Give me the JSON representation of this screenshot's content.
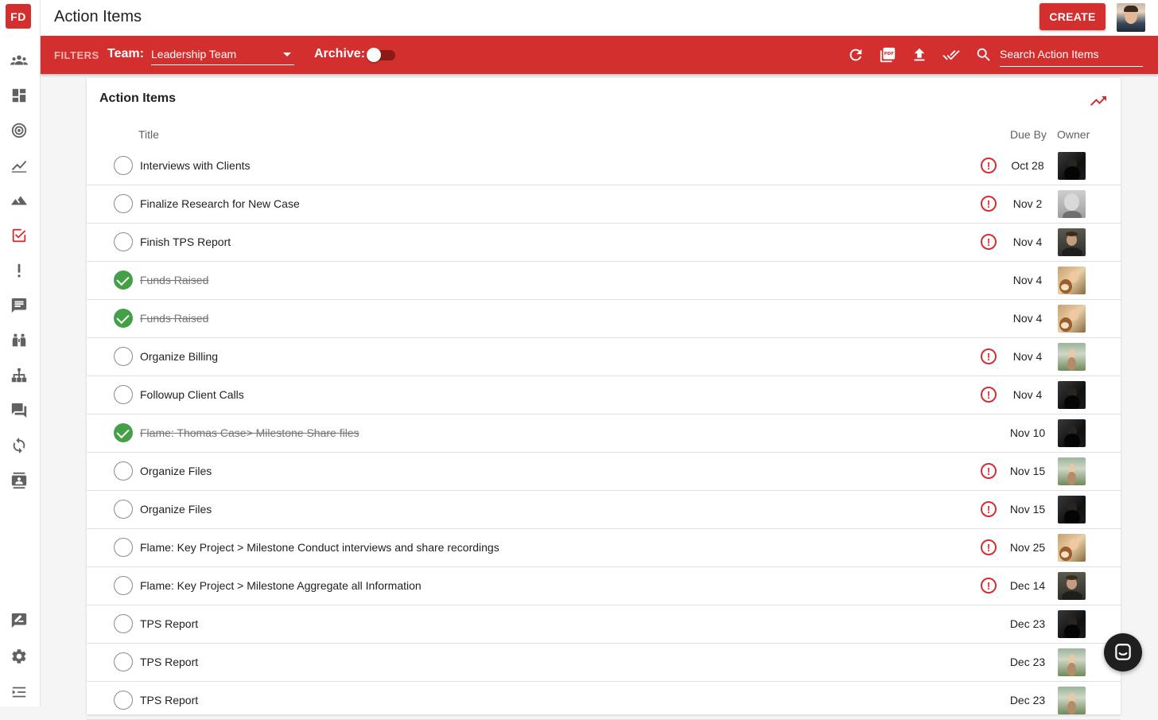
{
  "app": {
    "logo_text": "FD",
    "page_title": "Action Items",
    "create_label": "CREATE"
  },
  "filters": {
    "filters_label": "FILTERS",
    "team_label": "Team:",
    "team_value": "Leadership Team",
    "archive_label": "Archive:",
    "archive_on": false,
    "search_placeholder": "Search Action Items"
  },
  "card": {
    "title": "Action Items",
    "columns": {
      "title": "Title",
      "due_by": "Due By",
      "owner": "Owner"
    }
  },
  "colors": {
    "brand": "#d32f2f",
    "done": "#43a047"
  },
  "items": [
    {
      "title": "Interviews with Clients",
      "due": "Oct 28",
      "done": false,
      "overdue": true,
      "owner": "dark"
    },
    {
      "title": "Finalize Research for New Case",
      "due": "Nov 2",
      "done": false,
      "overdue": true,
      "owner": "bald"
    },
    {
      "title": "Finish TPS Report",
      "due": "Nov 4",
      "done": false,
      "overdue": true,
      "owner": "man"
    },
    {
      "title": "Funds Raised",
      "due": "Nov 4",
      "done": true,
      "overdue": false,
      "owner": "dog"
    },
    {
      "title": "Funds Raised",
      "due": "Nov 4",
      "done": true,
      "overdue": false,
      "owner": "dog"
    },
    {
      "title": "Organize Billing",
      "due": "Nov 4",
      "done": false,
      "overdue": true,
      "owner": "outdoor"
    },
    {
      "title": "Followup Client Calls",
      "due": "Nov 4",
      "done": false,
      "overdue": true,
      "owner": "dark"
    },
    {
      "title": "Flame: Thomas Case> Milestone Share files",
      "due": "Nov 10",
      "done": true,
      "overdue": false,
      "owner": "dark"
    },
    {
      "title": "Organize Files",
      "due": "Nov 15",
      "done": false,
      "overdue": true,
      "owner": "outdoor"
    },
    {
      "title": "Organize Files",
      "due": "Nov 15",
      "done": false,
      "overdue": true,
      "owner": "dark"
    },
    {
      "title": "Flame: Key Project > Milestone Conduct interviews and share recordings",
      "due": "Nov 25",
      "done": false,
      "overdue": true,
      "owner": "dog"
    },
    {
      "title": "Flame: Key Project > Milestone Aggregate all Information",
      "due": "Dec 14",
      "done": false,
      "overdue": true,
      "owner": "man"
    },
    {
      "title": "TPS Report",
      "due": "Dec 23",
      "done": false,
      "overdue": false,
      "owner": "dark"
    },
    {
      "title": "TPS Report",
      "due": "Dec 23",
      "done": false,
      "overdue": false,
      "owner": "outdoor"
    },
    {
      "title": "TPS Report",
      "due": "Dec 23",
      "done": false,
      "overdue": false,
      "owner": "outdoor"
    }
  ]
}
